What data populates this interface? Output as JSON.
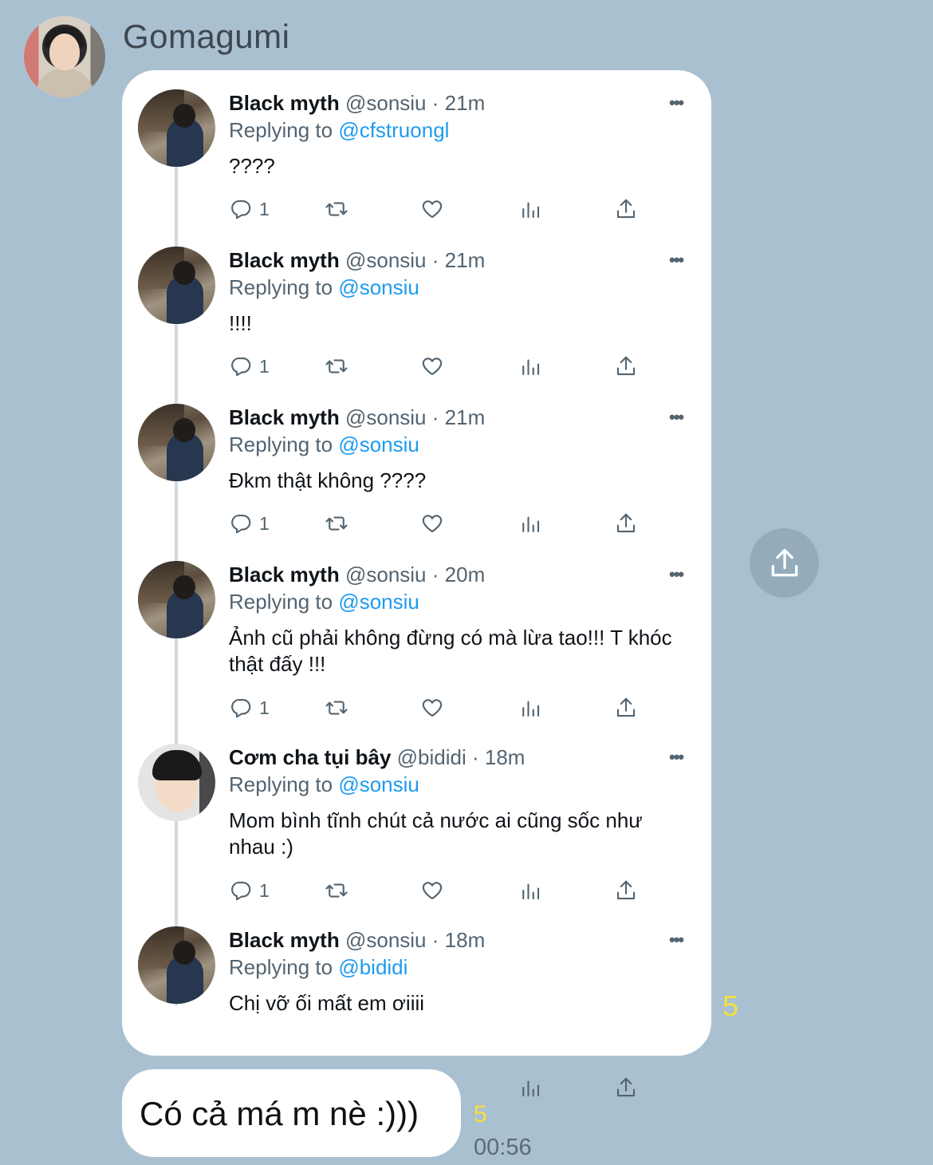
{
  "chat": {
    "sender_name": "Gomagumi",
    "forwarded_read_count": "5",
    "message_text": "Có cả má m nè :)))",
    "message_read_count": "5",
    "message_time": "00:56"
  },
  "tweets": [
    {
      "name": "Black myth",
      "handle": "@sonsiu",
      "time": "· 21m",
      "replying_label": "Replying to",
      "replying_to": "@cfstruongl",
      "text": "????",
      "replies": "1",
      "avatar": "black-myth-avatar"
    },
    {
      "name": "Black myth",
      "handle": "@sonsiu",
      "time": "· 21m",
      "replying_label": "Replying to",
      "replying_to": "@sonsiu",
      "text": "!!!!",
      "replies": "1",
      "avatar": "black-myth-avatar"
    },
    {
      "name": "Black myth",
      "handle": "@sonsiu",
      "time": "· 21m",
      "replying_label": "Replying to",
      "replying_to": "@sonsiu",
      "text": "Đkm thật không ????",
      "replies": "1",
      "avatar": "black-myth-avatar"
    },
    {
      "name": "Black myth",
      "handle": "@sonsiu",
      "time": "· 20m",
      "replying_label": "Replying to",
      "replying_to": "@sonsiu",
      "text": "Ảnh cũ phải không đừng có mà lừa tao!!! T khóc thật đấy !!!",
      "replies": "1",
      "avatar": "black-myth-avatar"
    },
    {
      "name": "Cơm cha tụi bây",
      "handle": "@bididi",
      "time": "· 18m",
      "replying_label": "Replying to",
      "replying_to": "@sonsiu",
      "text": "Mom bình tĩnh chút cả nước ai cũng sốc như nhau :)",
      "replies": "1",
      "avatar": "bididi-avatar"
    },
    {
      "name": "Black myth",
      "handle": "@sonsiu",
      "time": "· 18m",
      "replying_label": "Replying to",
      "replying_to": "@bididi",
      "text": "Chị vỡ ối mất em ơiiii",
      "replies": "",
      "avatar": "black-myth-avatar"
    }
  ],
  "icons": {
    "reply": "reply-icon",
    "retweet": "retweet-icon",
    "like": "like-icon",
    "views": "views-icon",
    "share": "share-icon",
    "more": "more-icon"
  },
  "colors": {
    "chat_background": "#a9c0d0",
    "link_blue": "#1d9bf0",
    "read_count_yellow": "#f4e13c"
  }
}
